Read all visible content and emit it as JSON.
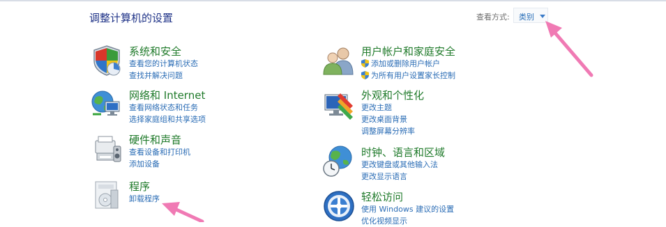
{
  "page": {
    "title": "调整计算机的设置",
    "view_by_label": "查看方式:",
    "view_by_value": "类别"
  },
  "categories": [
    {
      "icon": "system-security-icon",
      "title": "系统和安全",
      "links": [
        "查看您的计算机状态",
        "查找并解决问题"
      ]
    },
    {
      "icon": "network-internet-icon",
      "title": "网络和 Internet",
      "links": [
        "查看网络状态和任务",
        "选择家庭组和共享选项"
      ]
    },
    {
      "icon": "hardware-sound-icon",
      "title": "硬件和声音",
      "links": [
        "查看设备和打印机",
        "添加设备"
      ]
    },
    {
      "icon": "programs-icon",
      "title": "程序",
      "links": [
        "卸载程序"
      ]
    },
    {
      "icon": "user-accounts-icon",
      "title": "用户帐户和家庭安全",
      "links": [
        "添加或删除用户帐户",
        "为所有用户设置家长控制"
      ]
    },
    {
      "icon": "appearance-icon",
      "title": "外观和个性化",
      "links": [
        "更改主题",
        "更改桌面背景",
        "调整屏幕分辨率"
      ]
    },
    {
      "icon": "clock-language-region-icon",
      "title": "时钟、语言和区域",
      "links": [
        "更改键盘或其他输入法",
        "更改显示语言"
      ]
    },
    {
      "icon": "ease-of-access-icon",
      "title": "轻松访问",
      "links": [
        "使用 Windows 建议的设置",
        "优化视频显示"
      ]
    }
  ],
  "colors": {
    "title": "#1e3287",
    "category_title": "#1f7a2a",
    "link": "#2a6cb5",
    "annotation_arrow": "#f07ab4"
  }
}
